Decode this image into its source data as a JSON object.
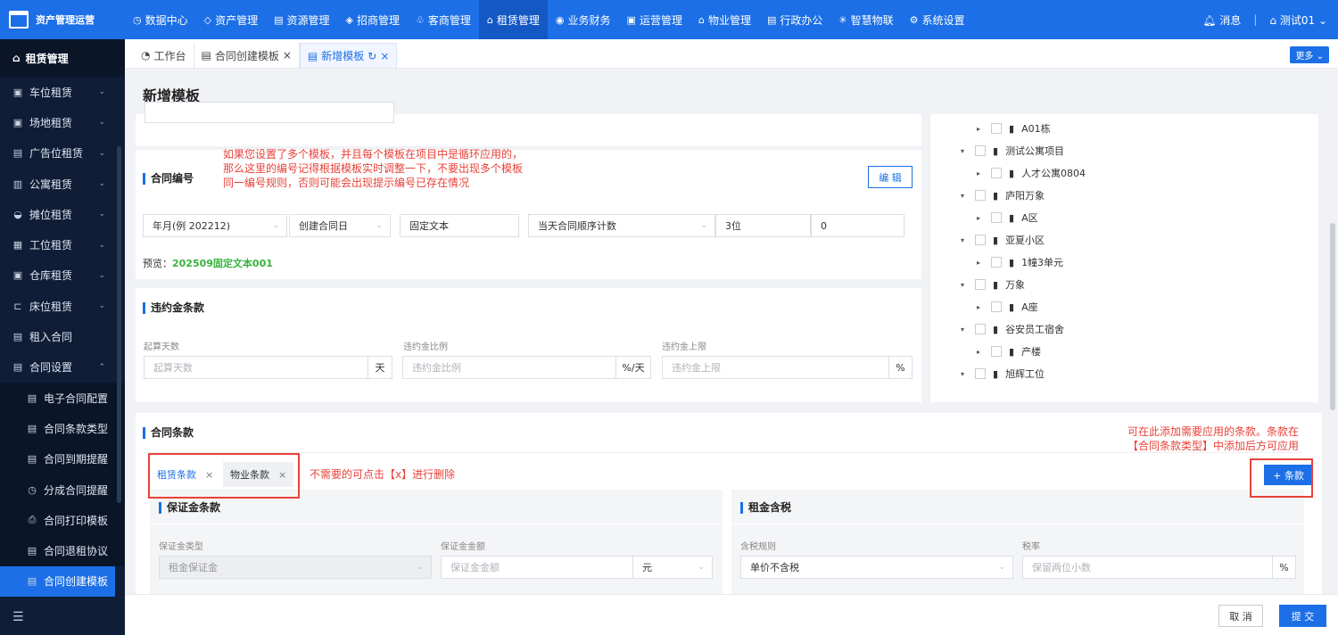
{
  "app": {
    "title": "资产管理运营"
  },
  "topnav": [
    "数据中心",
    "资产管理",
    "资源管理",
    "招商管理",
    "客商管理",
    "租赁管理",
    "业务财务",
    "运营管理",
    "物业管理",
    "行政办公",
    "智慧物联",
    "系统设置"
  ],
  "topnav_icons": [
    "◷",
    "◇",
    "▤",
    "◈",
    "♧",
    "⌂",
    "◉",
    "▣",
    "⌂",
    "▤",
    "✳",
    "⚙"
  ],
  "topright": {
    "messages": "消息",
    "user": "测试01"
  },
  "sidebar": {
    "header": "租赁管理",
    "items": [
      {
        "label": "车位租赁",
        "icon": "▣"
      },
      {
        "label": "场地租赁",
        "icon": "▣"
      },
      {
        "label": "广告位租赁",
        "icon": "▤"
      },
      {
        "label": "公寓租赁",
        "icon": "▥"
      },
      {
        "label": "摊位租赁",
        "icon": "◒"
      },
      {
        "label": "工位租赁",
        "icon": "▦"
      },
      {
        "label": "仓库租赁",
        "icon": "▣"
      },
      {
        "label": "床位租赁",
        "icon": "⊏"
      },
      {
        "label": "租入合同",
        "icon": "▤"
      },
      {
        "label": "合同设置",
        "icon": "▤"
      }
    ],
    "subitems": [
      {
        "label": "电子合同配置",
        "icon": "▤"
      },
      {
        "label": "合同条款类型",
        "icon": "▤"
      },
      {
        "label": "合同到期提醒",
        "icon": "▤"
      },
      {
        "label": "分成合同提醒",
        "icon": "◷"
      },
      {
        "label": "合同打印模板",
        "icon": "⎙"
      },
      {
        "label": "合同退租协议",
        "icon": "▤"
      },
      {
        "label": "合同创建模板",
        "icon": "▤"
      }
    ]
  },
  "tabs": [
    {
      "label": "工作台"
    },
    {
      "label": "合同创建模板"
    },
    {
      "label": "新增模板"
    }
  ],
  "tabs_more": "更多",
  "page_title": "新增模板",
  "contract_no": {
    "title": "合同编号",
    "edit_label": "编 辑",
    "fields": [
      "年月(例 202212)",
      "创建合同日",
      "固定文本",
      "当天合同顺序计数",
      "3位",
      "0"
    ],
    "preview_label": "预览：",
    "preview_value": "202509固定文本001"
  },
  "annotation1": "如果您设置了多个模板，并且每个模板在项目中是循环应用的，\n那么这里的编号记得根据模板实时调整一下，不要出现多个模板\n同一编号规则，否则可能会出现提示编号已存在情况",
  "penalty": {
    "title": "违约金条款",
    "labels": [
      "起算天数",
      "违约金比例",
      "违约金上限"
    ],
    "placeholders": [
      "起算天数",
      "违约金比例",
      "违约金上限"
    ],
    "units": [
      "天",
      "%/天",
      "%"
    ]
  },
  "tree": [
    {
      "label": "A01栋",
      "level": 1
    },
    {
      "label": "测试公寓项目",
      "level": 0
    },
    {
      "label": "人才公寓0804",
      "level": 1
    },
    {
      "label": "庐阳万象",
      "level": 0
    },
    {
      "label": "A区",
      "level": 1
    },
    {
      "label": "亚夏小区",
      "level": 0
    },
    {
      "label": "1幢3单元",
      "level": 1
    },
    {
      "label": "万象",
      "level": 0
    },
    {
      "label": "A座",
      "level": 1
    },
    {
      "label": "谷安员工宿舍",
      "level": 0
    },
    {
      "label": "产楼",
      "level": 1
    },
    {
      "label": "旭辉工位",
      "level": 0
    }
  ],
  "clauses": {
    "title": "合同条款",
    "tabs": [
      "租赁条款",
      "物业条款"
    ],
    "add_label": "+ 条款",
    "annotation_delete": "不需要的可点击【x】进行删除",
    "annotation_add": "可在此添加需要应用的条款。条款在\n【合同条款类型】中添加后方可应用",
    "deposit": {
      "title": "保证金条款",
      "labels": [
        "保证金类型",
        "保证金金额"
      ],
      "type_value": "租金保证金",
      "amount_placeholder": "保证金金额",
      "unit": "元"
    },
    "tax": {
      "title": "租金含税",
      "labels": [
        "含税规则",
        "税率"
      ],
      "rule_value": "单价不含税",
      "rate_placeholder": "保留两位小数",
      "unit": "%"
    }
  },
  "footer": {
    "cancel": "取 消",
    "submit": "提 交"
  }
}
